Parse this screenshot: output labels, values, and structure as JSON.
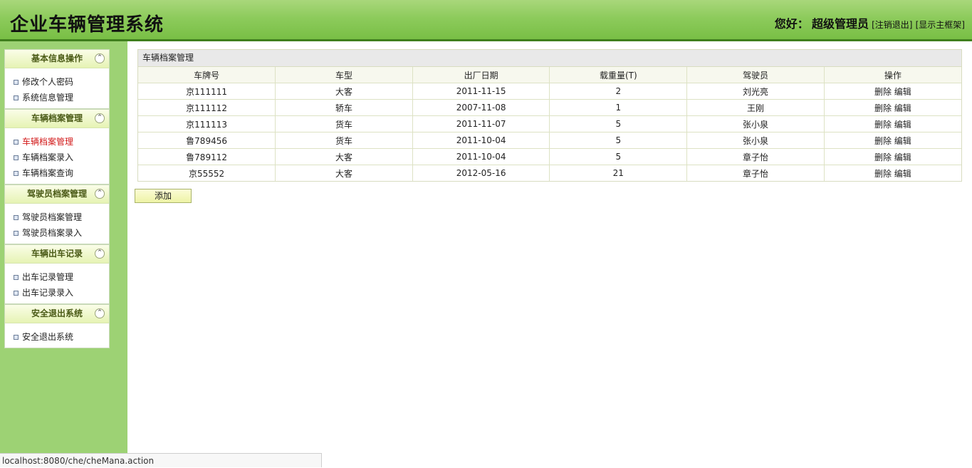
{
  "header": {
    "title": "企业车辆管理系统",
    "greeting": "您好：",
    "username": "超级管理员",
    "logout_link": "[注销退出]",
    "show_frame_link": "[显示主框架]"
  },
  "sidebar": {
    "panels": [
      {
        "title": "基本信息操作",
        "items": [
          "修改个人密码",
          "系统信息管理"
        ]
      },
      {
        "title": "车辆档案管理",
        "items": [
          "车辆档案管理",
          "车辆档案录入",
          "车辆档案查询"
        ]
      },
      {
        "title": "驾驶员档案管理",
        "items": [
          "驾驶员档案管理",
          "驾驶员档案录入"
        ]
      },
      {
        "title": "车辆出车记录",
        "items": [
          "出车记录管理",
          "出车记录录入"
        ]
      },
      {
        "title": "安全退出系统",
        "items": [
          "安全退出系统"
        ]
      }
    ],
    "collapse_glyph": "⌃"
  },
  "grid": {
    "caption": "车辆档案管理",
    "columns": [
      "车牌号",
      "车型",
      "出厂日期",
      "载重量(T)",
      "驾驶员",
      "操作"
    ],
    "rows": [
      [
        "京111111",
        "大客",
        "2011-11-15",
        "2",
        "刘光亮"
      ],
      [
        "京111112",
        "轿车",
        "2007-11-08",
        "1",
        "王刚"
      ],
      [
        "京111113",
        "货车",
        "2011-11-07",
        "5",
        "张小泉"
      ],
      [
        "鲁789456",
        "货车",
        "2011-10-04",
        "5",
        "张小泉"
      ],
      [
        "鲁789112",
        "大客",
        "2011-10-04",
        "5",
        "章子怡"
      ],
      [
        "京55552",
        "大客",
        "2012-05-16",
        "21",
        "章子怡"
      ]
    ],
    "delete_label": "删除",
    "edit_label": "编辑"
  },
  "add_button": "添加",
  "statusbar": {
    "url": "localhost:8080/che/cheMana.action"
  },
  "colors": {
    "header_green": "#79bf45",
    "sidebar_green": "#9dd274",
    "active_menu": "#d21a1a"
  }
}
